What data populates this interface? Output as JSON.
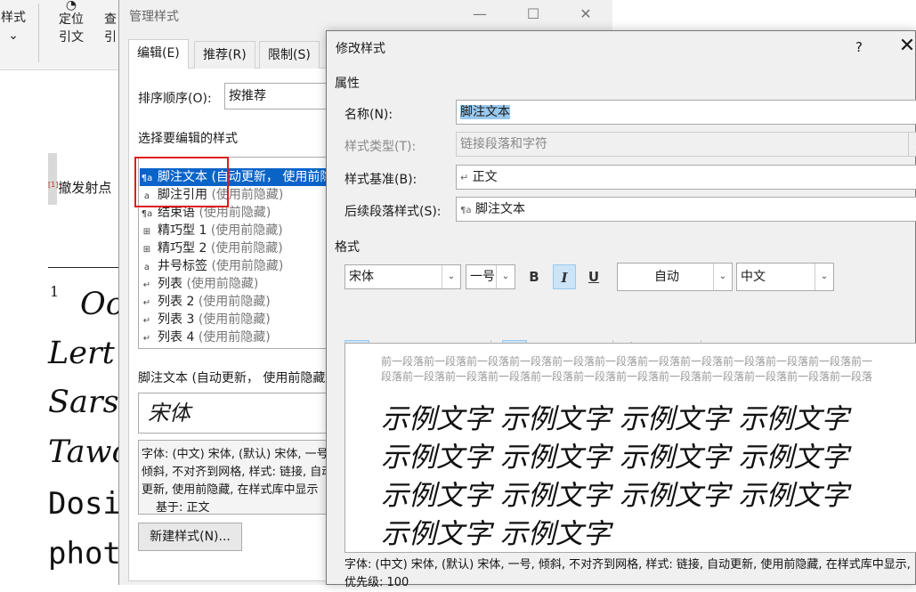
{
  "ribbon": {
    "partial_label": "样式",
    "locate_top": "定位",
    "locate_bottom": "引文",
    "lookup_top": "查",
    "lookup_bottom": "引"
  },
  "document": {
    "body_text": "撤发射点",
    "footnote_mark": "[1]",
    "footnote_number": "1",
    "footnote_lines": [
      "Oo",
      "Lert",
      "Sars",
      "Tawo",
      "Dosi",
      "phot"
    ]
  },
  "manage_dialog": {
    "title": "管理样式",
    "tabs": [
      "编辑(E)",
      "推荐(R)",
      "限制(S)"
    ],
    "sort_label": "排序顺序(O):",
    "sort_value": "按推荐",
    "select_label": "选择要编辑的样式",
    "styles": [
      {
        "icon": "¶a",
        "name": "脚注文本",
        "note": "(自动更新， 使用前隐藏)"
      },
      {
        "icon": "a",
        "name": "脚注引用",
        "note": "(使用前隐藏)"
      },
      {
        "icon": "¶a",
        "name": "结束语",
        "note": "(使用前隐藏)"
      },
      {
        "icon": "⊞",
        "name": "精巧型 1",
        "note": "(使用前隐藏)"
      },
      {
        "icon": "⊞",
        "name": "精巧型 2",
        "note": "(使用前隐藏)"
      },
      {
        "icon": "a",
        "name": "井号标签",
        "note": "(使用前隐藏)"
      },
      {
        "icon": "↵",
        "name": "列表",
        "note": "(使用前隐藏)"
      },
      {
        "icon": "↵",
        "name": "列表 2",
        "note": "(使用前隐藏)"
      },
      {
        "icon": "↵",
        "name": "列表 3",
        "note": "(使用前隐藏)"
      },
      {
        "icon": "↵",
        "name": "列表 4",
        "note": "(使用前隐藏)"
      }
    ],
    "selected_summary": "脚注文本 (自动更新， 使用前隐藏)",
    "preview_font": "宋体",
    "description": "字体: (中文) 宋体, (默认) 宋体, 一号, 倾斜, 不对齐到网格, 样式: 链接, 自动更新, 使用前隐藏, 在样式库中显示",
    "based_on": "基于: 正文",
    "new_style_button": "新建样式(N)..."
  },
  "modify_dialog": {
    "title": "修改样式",
    "help": "?",
    "close": "✕",
    "section_properties": "属性",
    "name_label": "名称(N):",
    "name_value": "脚注文本",
    "type_label": "样式类型(T):",
    "type_value": "链接段落和字符",
    "base_label": "样式基准(B):",
    "base_value": "正文",
    "next_label": "后续段落样式(S):",
    "next_value": "脚注文本",
    "section_format": "格式",
    "font": "宋体",
    "size": "一号",
    "bold": "B",
    "italic": "I",
    "underline": "U",
    "color": "自动",
    "script": "中文",
    "preview_prev_paragraph": "前一段落前一段落前一段落前一段落前一段落前一段落前一段落前一段落前一段落前一段落前一段落前一段落前一段落前一段落前一段落前一段落前一段落前一段落前一段落前一段落前一段落前一段落前一段落",
    "sample_text": "示例文字 示例文字 示例文字 示例文字 示例文字 示例文字 示例文字 示例文字 示例文字 示例文字 示例文字 示例文字 示例文字 示例文字",
    "description": "字体: (中文) 宋体, (默认) 宋体, 一号, 倾斜, 不对齐到网格, 样式: 链接, 自动更新, 使用前隐藏, 在样式库中显示, 优先级: 100"
  },
  "colors": {
    "selection": "#0a64c8",
    "highlight_box": "#e0191d",
    "toggle_on": "#cce4f7"
  }
}
